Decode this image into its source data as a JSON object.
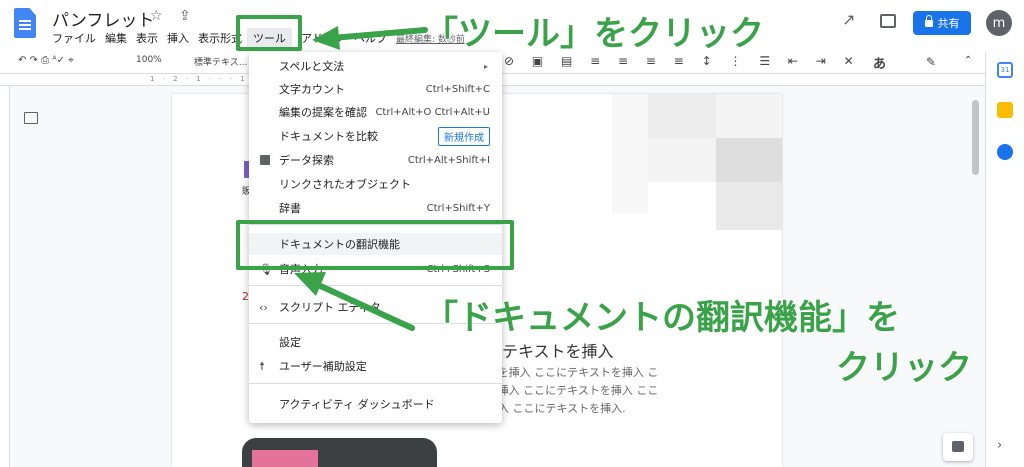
{
  "header": {
    "title": "パンフレット",
    "title_icons": "☆ ⇪",
    "menus": [
      "ファイル",
      "編集",
      "表示",
      "挿入",
      "表示形式",
      "ツール",
      "アドオン",
      "ヘルプ"
    ],
    "last_edit": "最終編集: 数秒前",
    "share_label": "共有",
    "avatar_initial": "m"
  },
  "toolbar": {
    "undo_redo": "↶ ↷ ⎙ ᴬ✓ ⌖",
    "zoom": "100%",
    "style": "標準テキス...",
    "right_icons": "⊘ ▣ ▤ ≡ ≡ ≡ ≡ ↕ ⋮ ☰ ⇤ ⇥ ✕",
    "ime": "あ",
    "edit_mode": "✎"
  },
  "ruler": {
    "marks": "1 · 2 · 1 · · · 1 · · · 2 · · · 3 · · · 4 · · · 5 · · · 6"
  },
  "side_panel": {
    "calendar": "31",
    "expand": "›"
  },
  "page": {
    "body_lines": [
      "テキストを挿入 ここにテキストを挿入 こ",
      "キストを挿入 ここにテキストを挿入 ここ",
      "ストを挿入 ここにテキストを挿入."
    ],
    "heading": "ここにテキストを挿入",
    "left_snippets": [
      "販",
      "20"
    ]
  },
  "menu": {
    "items": [
      {
        "label": "スペルと文法",
        "shortcut": "",
        "arrow": "▸"
      },
      {
        "label": "文字カウント",
        "shortcut": "Ctrl+Shift+C"
      },
      {
        "label": "編集の提案を確認",
        "shortcut": "Ctrl+Alt+O Ctrl+Alt+U"
      },
      {
        "label": "ドキュメントを比較",
        "badge": "新規作成"
      },
      {
        "label": "データ探索",
        "shortcut": "Ctrl+Alt+Shift+I"
      },
      {
        "label": "リンクされたオブジェクト",
        "shortcut": ""
      },
      {
        "label": "辞書",
        "shortcut": "Ctrl+Shift+Y"
      },
      {
        "label": "ドキュメントの翻訳機能",
        "shortcut": ""
      },
      {
        "label": "音声入力",
        "shortcut": "Ctrl+Shift+S"
      },
      {
        "label": "スクリプト エディタ",
        "shortcut": ""
      },
      {
        "label": "設定",
        "shortcut": ""
      },
      {
        "label": "ユーザー補助設定",
        "shortcut": ""
      },
      {
        "label": "アクティビティ ダッシュボード",
        "shortcut": ""
      }
    ]
  },
  "annotations": {
    "tool_hint": "「ツール」をクリック",
    "translate_hint_1": "「ドキュメントの翻訳機能」を",
    "translate_hint_2": "クリック",
    "color": "#3aa34a"
  }
}
